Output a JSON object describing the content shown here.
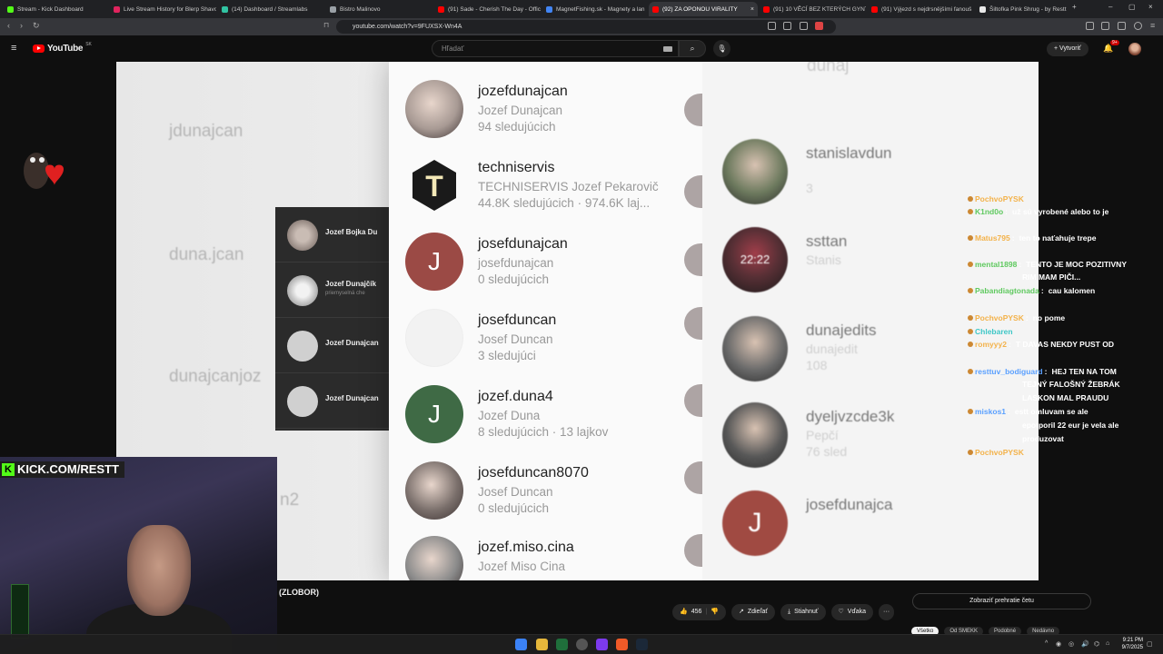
{
  "tabs": [
    {
      "label": "Stream - Kick Dashboard",
      "color": "#53fc18"
    },
    {
      "label": "Live Stream History for Blerp Shavo",
      "color": "#e0245e"
    },
    {
      "label": "(14) Dashboard / Streamlabs",
      "color": "#31c3a2"
    },
    {
      "label": "Bistro Malinovo",
      "color": "#9aa0a6"
    },
    {
      "label": "(91) Sade - Cherish The Day - Offic",
      "color": "#ff0000"
    },
    {
      "label": "MagnetFishing.sk - Magnety a lan",
      "color": "#4285f4"
    },
    {
      "label": "(92) ZA OPONOU VIRALITY",
      "color": "#ff0000"
    },
    {
      "label": "(91) 10 VĚCÍ BEZ KTERÝCH GYNTE",
      "color": "#ff0000"
    },
    {
      "label": "(91) Výjezd s nejdrsnějšími fanouš",
      "color": "#ff0000"
    },
    {
      "label": "Šiltofka Pink Shrug - by Restt",
      "color": "#e8e8e8"
    }
  ],
  "tab_close": "×",
  "new_tab": "+",
  "address": "youtube.com/watch?v=9FUXSX-Wn4A",
  "youtube": {
    "logo": "YouTube",
    "country": "SK",
    "search_placeholder": "Hľadať",
    "create": "Vytvoriť",
    "notifications": "9+"
  },
  "video_content": {
    "left_ghost": [
      "jdunajcan",
      "duna.jcan",
      "dunajcanjoz",
      "n2"
    ],
    "popup": [
      {
        "name": "Jozef Bojka Du",
        "sub": ""
      },
      {
        "name": "Jozef Dunajčík",
        "sub": "priemyselná che"
      },
      {
        "name": "Jozef Dunajcan",
        "sub": ""
      },
      {
        "name": "Jozef Dunajcan",
        "sub": ""
      }
    ],
    "main_list": [
      {
        "username": "jozefdunajcan",
        "name": "Jozef Dunajcan",
        "stats": "94 sledujúcich",
        "avatar": "photo",
        "color": "#a89a94",
        "letter": ""
      },
      {
        "username": "techniservis",
        "name": "TECHNISERVIS Jozef Pekarovič",
        "stats": "44.8K sledujúcich · 974.6K laj...",
        "avatar": "hex",
        "color": "#1a1a1a",
        "letter": "T"
      },
      {
        "username": "josefdunajcan",
        "name": "josefdunajcan",
        "stats": "0 sledujúcich",
        "avatar": "letter",
        "color": "#9b4a45",
        "letter": "J"
      },
      {
        "username": "josefduncan",
        "name": "Josef Duncan",
        "stats": "3 sledujúci",
        "avatar": "blank",
        "color": "#f2f2f2",
        "letter": ""
      },
      {
        "username": "jozef.duna4",
        "name": "Jozef Duna",
        "stats": "8 sledujúcich · 13 lajkov",
        "avatar": "letter",
        "color": "#3f6a45",
        "letter": "J"
      },
      {
        "username": "josefduncan8070",
        "name": "Josef Duncan",
        "stats": "0 sledujúcich",
        "avatar": "photo",
        "color": "#7a6f6b",
        "letter": ""
      },
      {
        "username": "jozef.miso.cina",
        "name": "Jozef Miso Cina",
        "stats": "",
        "avatar": "photo",
        "color": "#8a8a8a",
        "letter": ""
      }
    ],
    "right_list": [
      {
        "username": "stanislavdun",
        "name": "",
        "stats": "3",
        "color": "#6d7a5e",
        "letter": ""
      },
      {
        "username": "ssttan",
        "name": "Stanis",
        "stats": "",
        "color": "#5a3036",
        "letter": "22:22"
      },
      {
        "username": "dunajedits",
        "name": "dunajedit",
        "stats": "108",
        "color": "#6a6a6a",
        "letter": ""
      },
      {
        "username": "dyeljvzcde3k",
        "name": "Pepčí",
        "stats": "76 sled",
        "color": "#585858",
        "letter": ""
      },
      {
        "username": "josefdunajca",
        "name": "",
        "stats": "",
        "color": "#a04a42",
        "letter": "J"
      }
    ],
    "top_right_ghost": "dunaj"
  },
  "overlay": {
    "kick_banner": "KICK.COM/RESTT",
    "kick_letter": "K"
  },
  "chat": [
    {
      "user": "PochvoPYSK",
      "color": "#f3b24a",
      "text": ""
    },
    {
      "user": "K1nd0o",
      "color": "#5fc95f",
      "text": "už sú vyrobené alebo to je"
    },
    {
      "user": "Matus795",
      "color": "#f3b24a",
      "text": "ten to naťahuje trepe"
    },
    {
      "user": "mental1898",
      "color": "#5fc95f",
      "text": "TENTO JE MOC POZITIVNY"
    },
    {
      "user": "",
      "color": "#ffffff",
      "text": "RIM MAM PIČI..."
    },
    {
      "user": "Pabandiagtonada",
      "color": "#5fc95f",
      "text": "cau kalomen"
    },
    {
      "user": "PochvoPYSK",
      "color": "#f3b24a",
      "text": "no pome"
    },
    {
      "user": "Chlebaren",
      "color": "#3ec7c7",
      "text": ""
    },
    {
      "user": "romyyy2",
      "color": "#f3b24a",
      "text": "T DAVAS NEKDY PUST OD"
    },
    {
      "user": "resttuv_bodiguard",
      "color": "#5aa0ff",
      "text": "HEJ TEN NA TOM"
    },
    {
      "user": "",
      "color": "#ffffff",
      "text": "TEJNÝ FALOŠNÝ ŽEBRÁK"
    },
    {
      "user": "",
      "color": "#ffffff",
      "text": "LASKON MAL PRAUDU"
    },
    {
      "user": "miskos1",
      "color": "#5aa0ff",
      "text": "estt omluvam se ale"
    },
    {
      "user": "",
      "color": "#ffffff",
      "text": "epotporil 22 eur je vela ale"
    },
    {
      "user": "",
      "color": "#ffffff",
      "text": "produzovat"
    },
    {
      "user": "PochvoPYSK",
      "color": "#f3b24a",
      "text": ""
    }
  ],
  "below": {
    "title": "(ZLOBOR)",
    "likes": "456",
    "share": "Zdieľať",
    "download": "Stiahnuť",
    "thanks": "Vďaka",
    "more": "···",
    "chat_replay": "Zobraziť prehratie četu",
    "chips": [
      "Všetko",
      "Od SMEKK",
      "Podobné",
      "Nedávno"
    ]
  },
  "taskbar": {
    "time": "9:21 PM",
    "date": "9/7/2025"
  }
}
